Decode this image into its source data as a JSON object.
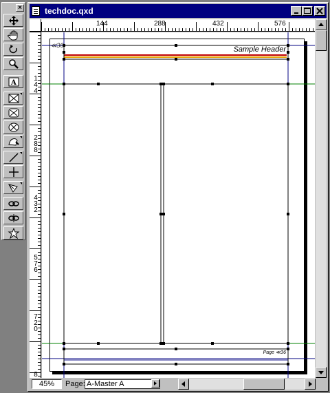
{
  "palette": {
    "close_label": "×",
    "tools": [
      {
        "name": "item-tool",
        "icon": "move-arrows-icon"
      },
      {
        "name": "content-tool",
        "icon": "hand-icon"
      },
      {
        "name": "rotation-tool",
        "icon": "rotate-icon"
      },
      {
        "name": "zoom-tool",
        "icon": "magnifier-icon"
      },
      {
        "name": "text-box-tool",
        "icon": "text-box-icon"
      },
      {
        "name": "picture-box-tool",
        "icon": "picture-box-icon"
      },
      {
        "name": "rect-picture-tool",
        "icon": "rect-picture-icon"
      },
      {
        "name": "oval-picture-tool",
        "icon": "oval-picture-icon"
      },
      {
        "name": "bezier-picture-tool",
        "icon": "bezier-picture-icon"
      },
      {
        "name": "line-tool",
        "icon": "line-icon"
      },
      {
        "name": "orthogonal-line-tool",
        "icon": "cross-line-icon"
      },
      {
        "name": "pen-tool",
        "icon": "pen-icon"
      },
      {
        "name": "linking-tool",
        "icon": "link-icon"
      },
      {
        "name": "unlinking-tool",
        "icon": "unlink-icon"
      },
      {
        "name": "star-tool",
        "icon": "star-icon"
      }
    ]
  },
  "window": {
    "title": "techdoc.qxd",
    "minimize_label": "_",
    "maximize_label": "□",
    "close_label": "×"
  },
  "ruler": {
    "h_labels": [
      "144",
      "288",
      "432",
      "576"
    ],
    "v_labels": [
      {
        "text": "1\n4\n4"
      },
      {
        "text": "2\n8\n8"
      },
      {
        "text": "4\n3\n2"
      },
      {
        "text": "5\n7\n6"
      },
      {
        "text": "7\n2\n0"
      },
      {
        "text": "8"
      }
    ]
  },
  "page": {
    "header_text": "Sample Header",
    "corner_tag": "≪36",
    "footer_text": "Page ≪36"
  },
  "bottombar": {
    "zoom": "45%",
    "page_label": "Page:",
    "page_value": "A-Master A"
  },
  "colors": {
    "titlebar": "#000080",
    "margin_guide": "#000080",
    "column_guide": "#008000",
    "header_rule_top": "#c00000",
    "header_rule_bottom": "#e8a000"
  }
}
